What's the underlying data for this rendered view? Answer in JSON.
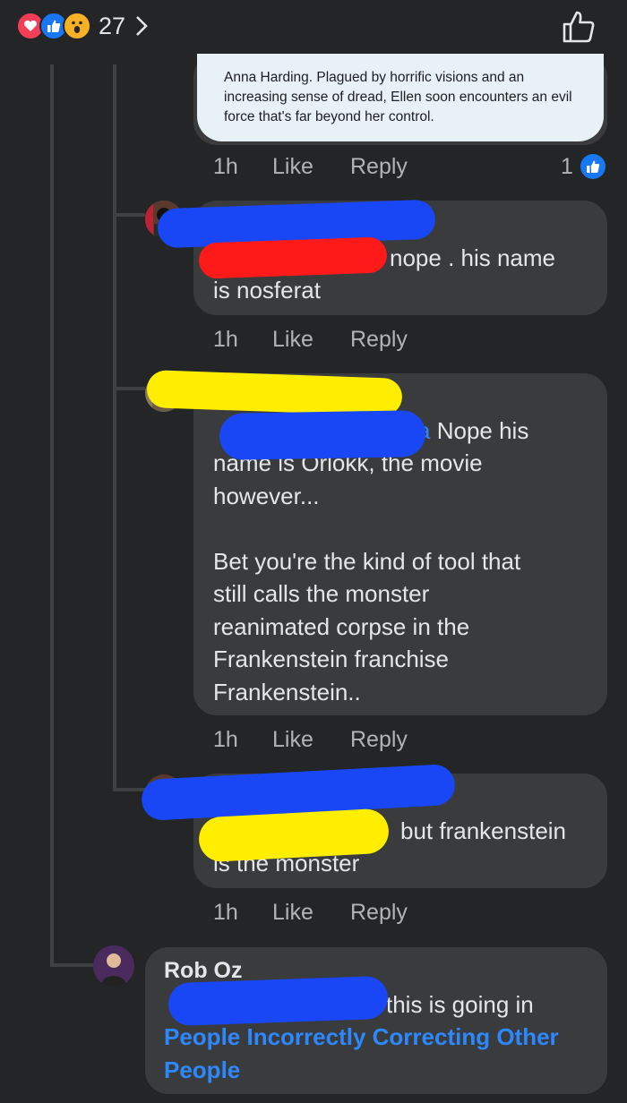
{
  "reactions": {
    "count": "27"
  },
  "quote": {
    "lines": [
      "Anna Harding. Plagued by horrific visions and an",
      "increasing sense of dread, Ellen soon encounters an evil",
      "force that's far beyond her control."
    ]
  },
  "comments": [
    {
      "time": "1h",
      "like": "Like",
      "reply": "Reply",
      "likes": "1"
    },
    {
      "text_after_mention": "nope . his name",
      "text_lines": [
        "is nosferat"
      ],
      "time": "1h",
      "like": "Like",
      "reply": "Reply"
    },
    {
      "mention_tail": "a",
      "text_after_mention": "Nope his",
      "text_lines": [
        "name is Orlokk, the movie",
        "however...",
        "",
        "Bet you're the kind of tool that",
        "still calls the monster",
        "reanimated corpse in the",
        "Frankenstein franchise",
        "Frankenstein.."
      ],
      "time": "1h",
      "like": "Like",
      "reply": "Reply"
    },
    {
      "text_after_mention": "but frankenstein",
      "text_lines": [
        "is the monster"
      ],
      "time": "1h",
      "like": "Like",
      "reply": "Reply"
    },
    {
      "author": "Rob Oz",
      "text_after_mention": "this is going in",
      "link_lines": [
        "People Incorrectly Correcting Other",
        "People"
      ]
    }
  ],
  "colors": {
    "background": "#242526",
    "bubble": "#3a3b3c",
    "link": "#2d88ff",
    "like_blue": "#1877f2",
    "scribble_blue": "#1a47f5",
    "scribble_red": "#ff1a1a",
    "scribble_yellow": "#ffee00"
  }
}
